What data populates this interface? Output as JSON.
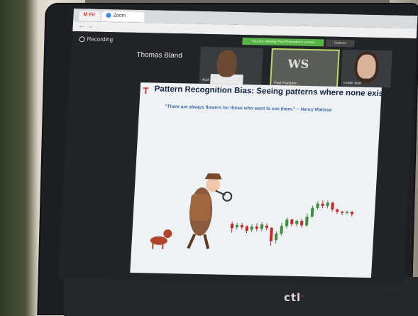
{
  "browser": {
    "tab_gmail_label": "M  Fir",
    "tab_zoom_label": "Zoom"
  },
  "zoom": {
    "recording_label": "Recording",
    "banner_text": "You are viewing Paul Frampton's screen",
    "banner_options": "Options",
    "speaker_name": "Thomas Bland",
    "participants": [
      {
        "label": "AGA Roanoke Chapter"
      },
      {
        "label": "Paul Frampton",
        "logo_text": "WS"
      },
      {
        "label": "Leslie Tesh"
      }
    ]
  },
  "slide": {
    "t_mark": "T",
    "title": "Pattern Recognition Bias: Seeing patterns where none exist.",
    "quote": "\"There are always flowers for those who want to see them.\" ~ Henry Matisse",
    "candles": [
      {
        "o": 50,
        "c": 46,
        "h": 52,
        "l": 42
      },
      {
        "o": 47,
        "c": 49,
        "h": 51,
        "l": 45
      },
      {
        "o": 49,
        "c": 47,
        "h": 51,
        "l": 45
      },
      {
        "o": 48,
        "c": 44,
        "h": 49,
        "l": 42
      },
      {
        "o": 45,
        "c": 48,
        "h": 50,
        "l": 43
      },
      {
        "o": 48,
        "c": 46,
        "h": 51,
        "l": 44
      },
      {
        "o": 46,
        "c": 50,
        "h": 52,
        "l": 44
      },
      {
        "o": 49,
        "c": 47,
        "h": 51,
        "l": 45
      },
      {
        "o": 47,
        "c": 35,
        "h": 48,
        "l": 31
      },
      {
        "o": 36,
        "c": 42,
        "h": 44,
        "l": 33
      },
      {
        "o": 42,
        "c": 49,
        "h": 52,
        "l": 40
      },
      {
        "o": 49,
        "c": 55,
        "h": 57,
        "l": 47
      },
      {
        "o": 55,
        "c": 51,
        "h": 56,
        "l": 49
      },
      {
        "o": 51,
        "c": 54,
        "h": 55,
        "l": 49
      },
      {
        "o": 54,
        "c": 50,
        "h": 56,
        "l": 48
      },
      {
        "o": 50,
        "c": 58,
        "h": 61,
        "l": 49
      },
      {
        "o": 58,
        "c": 66,
        "h": 68,
        "l": 57
      },
      {
        "o": 66,
        "c": 70,
        "h": 72,
        "l": 64
      },
      {
        "o": 70,
        "c": 68,
        "h": 73,
        "l": 66
      },
      {
        "o": 68,
        "c": 71,
        "h": 73,
        "l": 66
      },
      {
        "o": 71,
        "c": 65,
        "h": 72,
        "l": 63
      },
      {
        "o": 65,
        "c": 63,
        "h": 66,
        "l": 61
      },
      {
        "o": 63,
        "c": 62,
        "h": 64,
        "l": 60
      },
      {
        "o": 62,
        "c": 63,
        "h": 64,
        "l": 61
      },
      {
        "o": 63,
        "c": 61,
        "h": 64,
        "l": 59
      }
    ]
  },
  "laptop": {
    "brand": "ctl",
    "brand_dot": "."
  },
  "colors": {
    "candle_up": "#3a8f3a",
    "candle_down": "#c8262b",
    "slide_title": "#15233f",
    "quote": "#3b69a8"
  }
}
